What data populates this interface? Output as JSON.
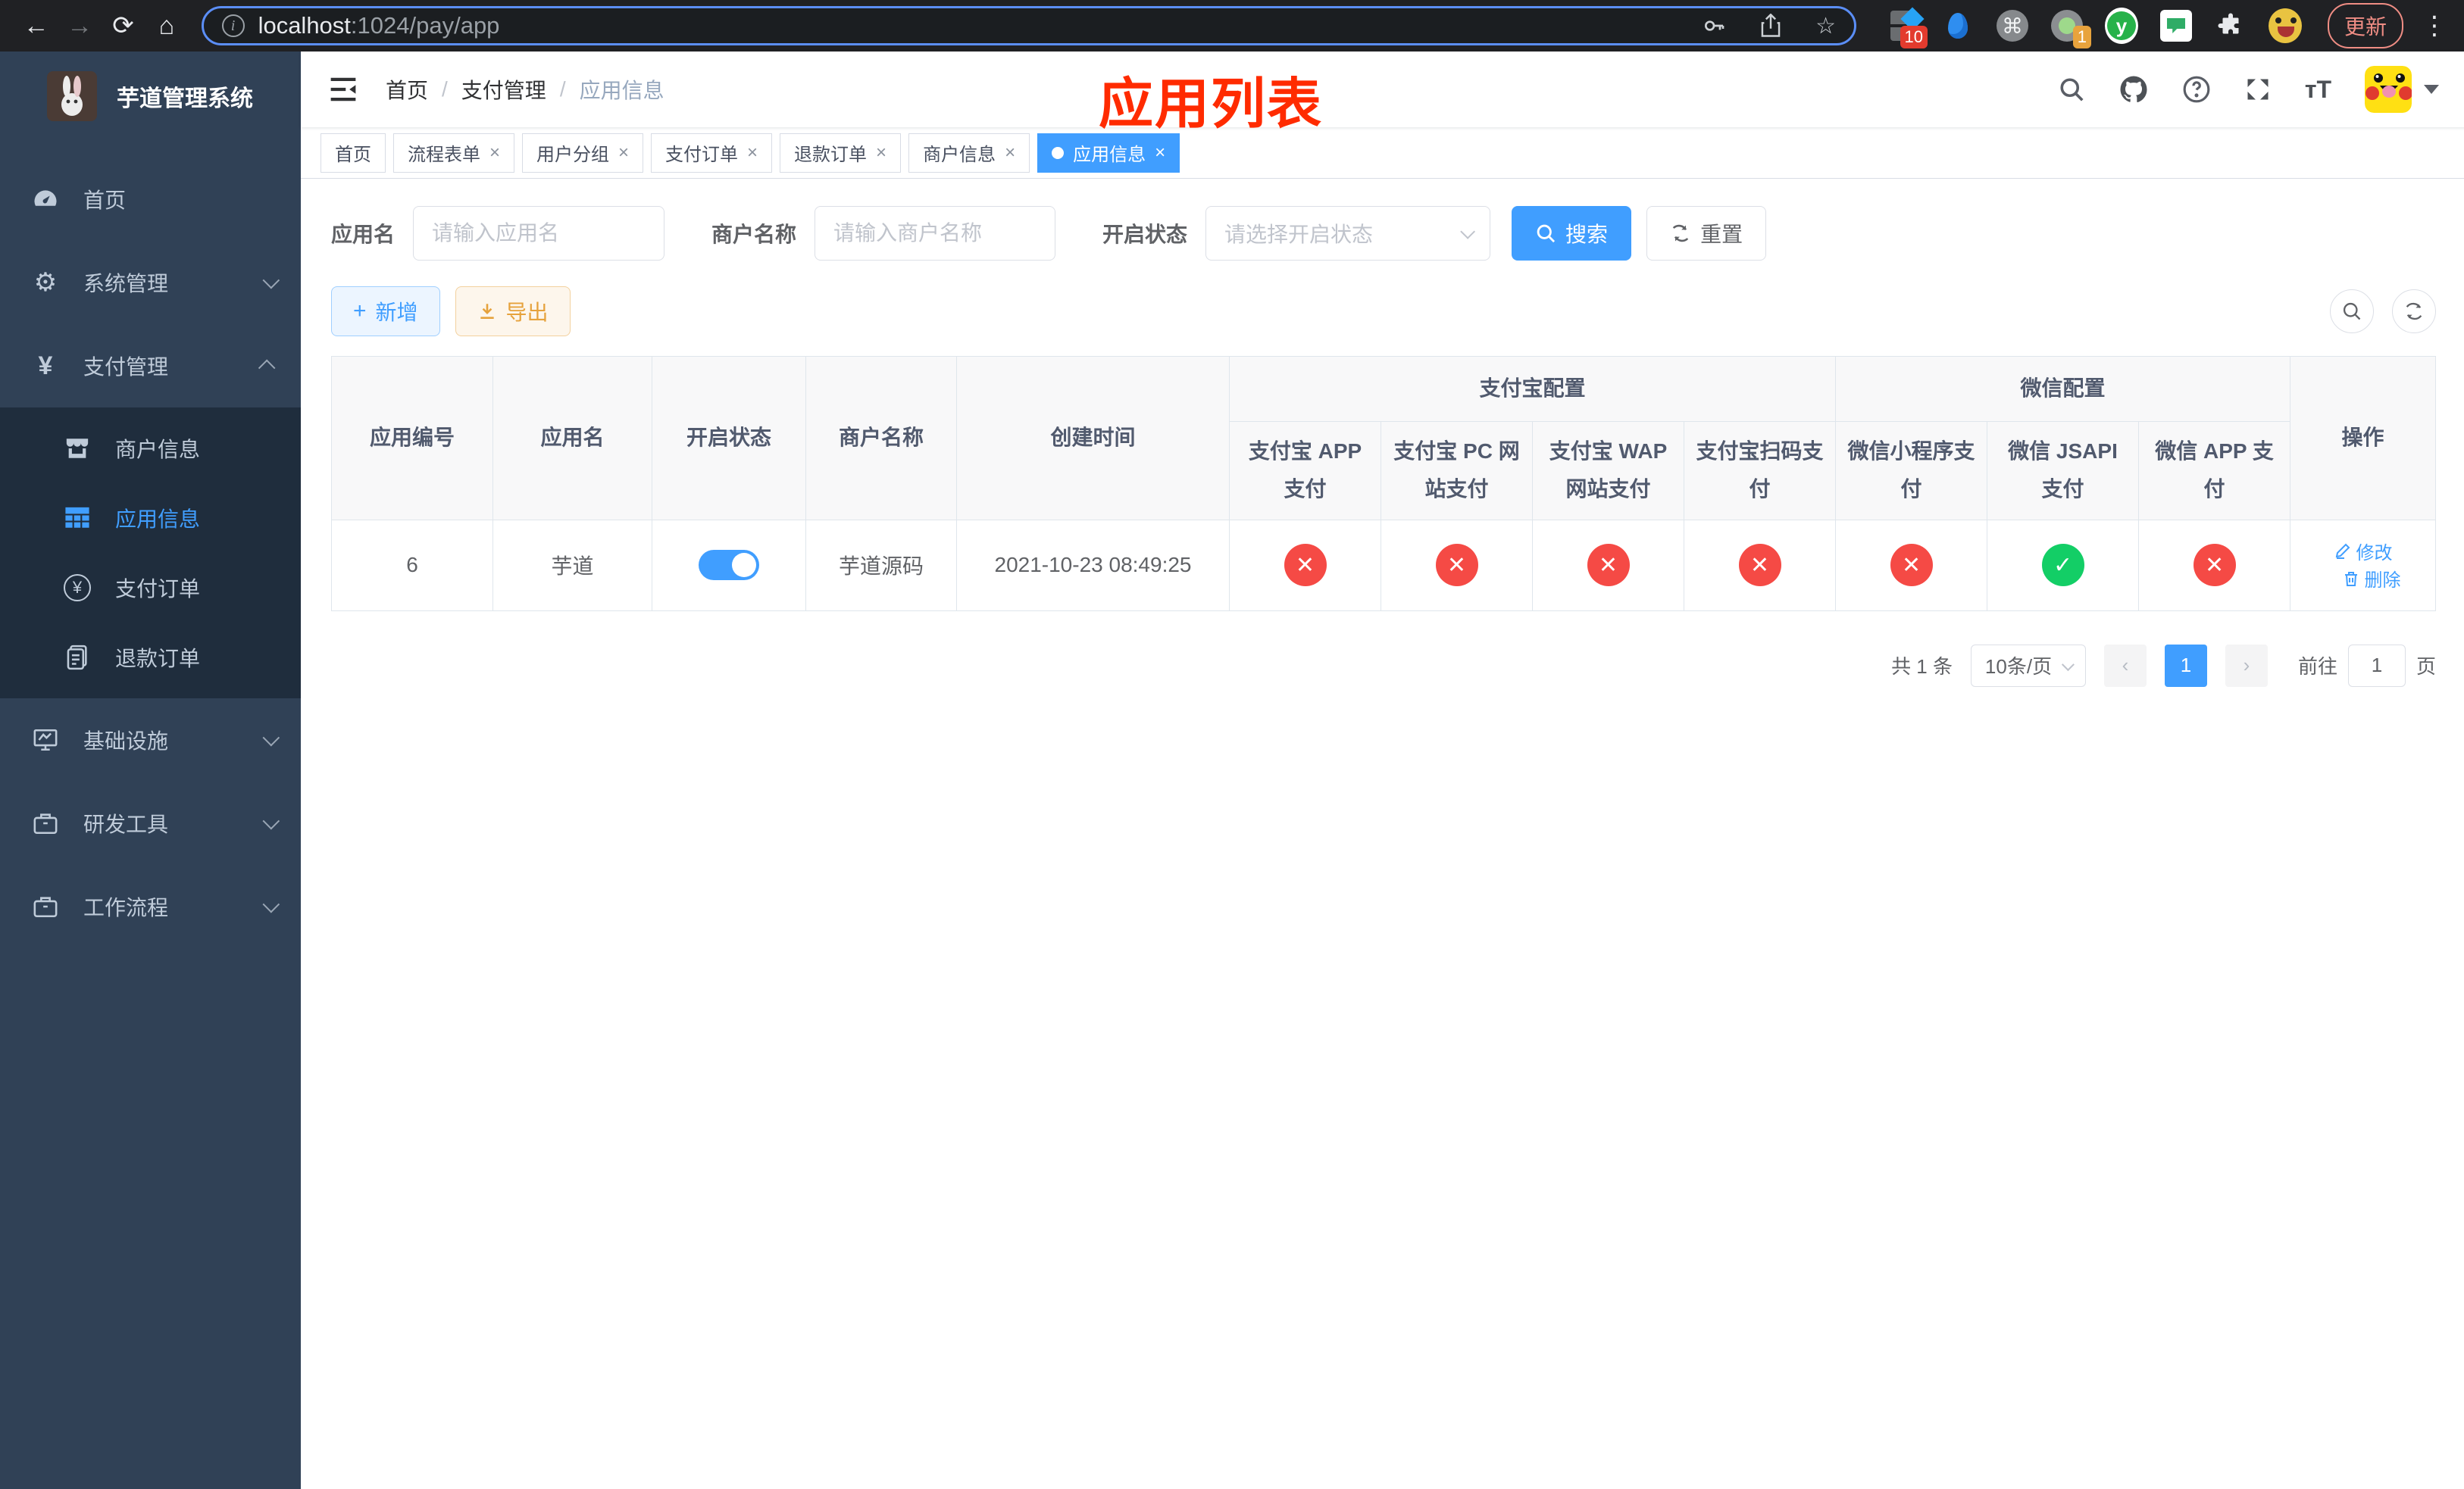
{
  "browser": {
    "url_host": "localhost",
    "url_path": ":1024/pay/app",
    "badge_ten": "10",
    "badge_one": "1",
    "update_label": "更新"
  },
  "sidebar": {
    "title": "芋道管理系统",
    "items": [
      {
        "label": "首页"
      },
      {
        "label": "系统管理"
      },
      {
        "label": "支付管理"
      },
      {
        "label": "基础设施"
      },
      {
        "label": "研发工具"
      },
      {
        "label": "工作流程"
      }
    ],
    "pay_children": [
      {
        "label": "商户信息"
      },
      {
        "label": "应用信息",
        "active": true
      },
      {
        "label": "支付订单"
      },
      {
        "label": "退款订单"
      }
    ]
  },
  "header": {
    "breadcrumb": [
      "首页",
      "支付管理",
      "应用信息"
    ],
    "overlay_title": "应用列表"
  },
  "tabs": [
    {
      "label": "首页",
      "closable": false,
      "active": false
    },
    {
      "label": "流程表单",
      "closable": true,
      "active": false
    },
    {
      "label": "用户分组",
      "closable": true,
      "active": false
    },
    {
      "label": "支付订单",
      "closable": true,
      "active": false
    },
    {
      "label": "退款订单",
      "closable": true,
      "active": false
    },
    {
      "label": "商户信息",
      "closable": true,
      "active": false
    },
    {
      "label": "应用信息",
      "closable": true,
      "active": true
    }
  ],
  "filters": {
    "app_name_label": "应用名",
    "app_name_placeholder": "请输入应用名",
    "merchant_label": "商户名称",
    "merchant_placeholder": "请输入商户名称",
    "status_label": "开启状态",
    "status_placeholder": "请选择开启状态",
    "search_label": "搜索",
    "reset_label": "重置"
  },
  "toolbar": {
    "add_label": "新增",
    "export_label": "导出"
  },
  "table": {
    "headers": {
      "id": "应用编号",
      "name": "应用名",
      "status": "开启状态",
      "merchant": "商户名称",
      "created": "创建时间",
      "alipay_group": "支付宝配置",
      "wechat_group": "微信配置",
      "alipay_cols": [
        "支付宝 APP 支付",
        "支付宝 PC 网站支付",
        "支付宝 WAP 网站支付",
        "支付宝扫码支付"
      ],
      "wechat_cols": [
        "微信小程序支付",
        "微信 JSAPI 支付",
        "微信 APP 支付"
      ],
      "ops": "操作"
    },
    "row": {
      "id": "6",
      "name": "芋道",
      "enabled": true,
      "merchant": "芋道源码",
      "created": "2021-10-23 08:49:25",
      "channels": [
        "off",
        "off",
        "off",
        "off",
        "off",
        "on",
        "off"
      ],
      "edit_label": "修改",
      "delete_label": "删除"
    }
  },
  "pagination": {
    "total_label": "共 1 条",
    "page_size_label": "10条/页",
    "page": "1",
    "goto_label": "前往",
    "goto_value": "1",
    "goto_unit": "页"
  },
  "colors": {
    "accent": "#409eff",
    "success": "#13ce66",
    "danger": "#f54a45",
    "warning": "#e6a23c",
    "overlay_title_red": "#ff2b00",
    "sidebar_bg": "#304156",
    "submenu_bg": "#1f2d3d"
  }
}
